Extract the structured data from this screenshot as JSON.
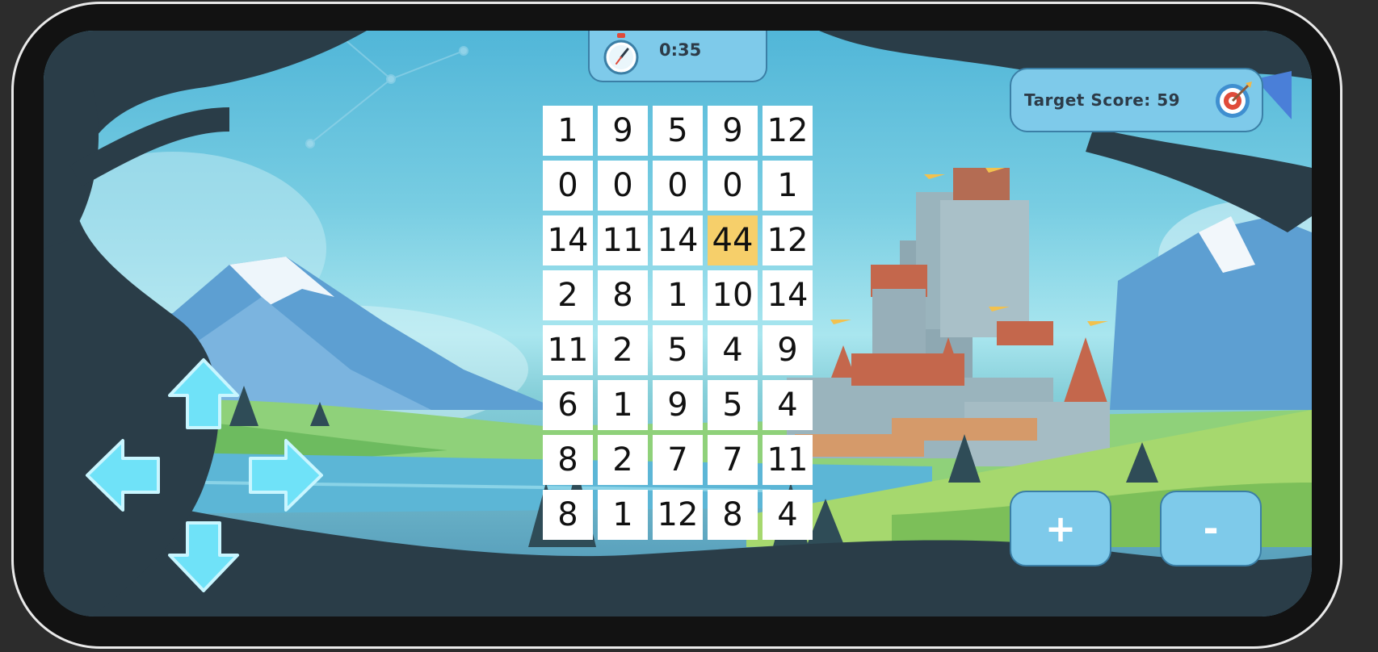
{
  "hud": {
    "timer": "0:35",
    "target_label": "Target Score: 59",
    "timer_icon": "stopwatch-icon",
    "target_icon": "target-icon"
  },
  "grid": {
    "rows": [
      [
        "1",
        "9",
        "5",
        "9",
        "12"
      ],
      [
        "0",
        "0",
        "0",
        "0",
        "1"
      ],
      [
        "14",
        "11",
        "14",
        "44",
        "12"
      ],
      [
        "2",
        "8",
        "1",
        "10",
        "14"
      ],
      [
        "11",
        "2",
        "5",
        "4",
        "9"
      ],
      [
        "6",
        "1",
        "9",
        "5",
        "4"
      ],
      [
        "8",
        "2",
        "7",
        "7",
        "11"
      ],
      [
        "8",
        "1",
        "12",
        "8",
        "4"
      ]
    ],
    "selected": {
      "row": 2,
      "col": 3
    }
  },
  "controls": {
    "plus_label": "+",
    "minus_label": "-",
    "dpad": [
      "up-arrow-icon",
      "left-arrow-icon",
      "right-arrow-icon",
      "down-arrow-icon"
    ]
  },
  "colors": {
    "panel": "#7ecaea",
    "panel_border": "#3b7fa6",
    "selected_cell": "#f6cf6a",
    "arrow": "#6fe2f8"
  }
}
